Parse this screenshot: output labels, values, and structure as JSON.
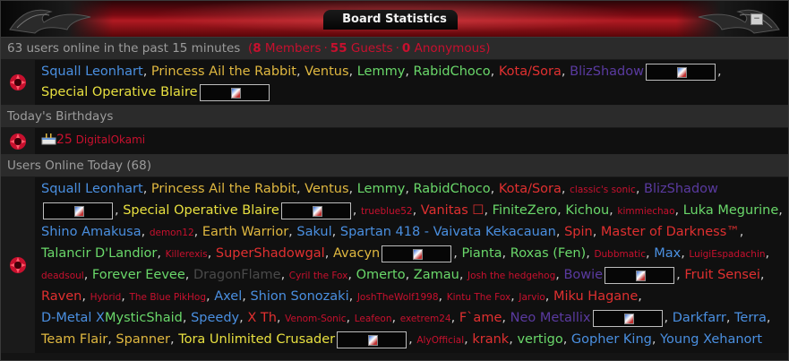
{
  "header": {
    "title": "Board Statistics",
    "collapse_label": "−"
  },
  "online": {
    "summary": "63 users online in the past 15 minutes",
    "members_count": "8",
    "members_label": "Members",
    "guests_count": "55",
    "guests_label": "Guests",
    "anon_count": "0",
    "anon_label": "Anonymous",
    "open_paren": "(",
    "close_paren": ")",
    "sep": "·",
    "users": [
      {
        "name": "Squall Leonhart",
        "color": "#4a8fe0"
      },
      {
        "name": "Princess Ail the Rabbit",
        "color": "#e0b840"
      },
      {
        "name": "Ventus",
        "color": "#e0b840"
      },
      {
        "name": "Lemmy",
        "color": "#6ad86a"
      },
      {
        "name": "RabidChoco",
        "color": "#6ad86a"
      },
      {
        "name": "Kota/Sora",
        "color": "#e03030"
      },
      {
        "name": "BlizShadow",
        "color": "#5a3aa0",
        "hidden": true,
        "newline_after": true
      },
      {
        "name": "Special Operative Blaire",
        "color": "#e8e040",
        "hidden": true,
        "last": true
      }
    ]
  },
  "birthdays": {
    "header": "Today's Birthdays",
    "age": "25",
    "name": "DigitalOkami",
    "color": "#c8102e"
  },
  "today": {
    "header": "Users Online Today (68)",
    "users": [
      {
        "name": "Squall Leonhart",
        "color": "#4a8fe0"
      },
      {
        "name": "Princess Ail the Rabbit",
        "color": "#e0b840"
      },
      {
        "name": "Ventus",
        "color": "#e0b840"
      },
      {
        "name": "Lemmy",
        "color": "#6ad86a"
      },
      {
        "name": "RabidChoco",
        "color": "#6ad86a"
      },
      {
        "name": "Kota/Sora",
        "color": "#e03030"
      },
      {
        "name": "classic's sonic",
        "color": "#c8102e",
        "small": true
      },
      {
        "name": "BlizShadow",
        "color": "#5a3aa0",
        "hidden": true
      },
      {
        "name": "Special Operative Blaire",
        "color": "#e8e040",
        "hidden": true
      },
      {
        "name": "trueblue52",
        "color": "#c8102e",
        "small": true
      },
      {
        "name": "Vanitas",
        "color": "#e03030",
        "suffix": " ☐"
      },
      {
        "name": "FiniteZero",
        "color": "#6ad86a"
      },
      {
        "name": "Kichou",
        "color": "#6ad86a"
      },
      {
        "name": "kimmiechao",
        "color": "#c8102e",
        "small": true
      },
      {
        "name": "Luka Megurine",
        "color": "#6ad86a"
      },
      {
        "name": "Shino Amakusa",
        "color": "#4a8fe0"
      },
      {
        "name": "demon12",
        "color": "#c8102e",
        "small": true
      },
      {
        "name": "Earth Warrior",
        "color": "#e0b840"
      },
      {
        "name": "Sakul",
        "color": "#4a8fe0"
      },
      {
        "name": "Spartan 418 - Vaivata Kekacauan",
        "color": "#4a8fe0"
      },
      {
        "name": "Spin",
        "color": "#e03030"
      },
      {
        "name": "Master of Darkness™",
        "color": "#e03030"
      },
      {
        "name": "Talancir D'Landior",
        "color": "#6ad86a"
      },
      {
        "name": "Killerexis",
        "color": "#c8102e",
        "small": true
      },
      {
        "name": "SuperShadowgal",
        "color": "#e03030"
      },
      {
        "name": "Avacyn",
        "color": "#e0b840",
        "hidden": true
      },
      {
        "name": "Pianta",
        "color": "#6ad86a"
      },
      {
        "name": "Roxas (Fen)",
        "color": "#6ad86a"
      },
      {
        "name": "Dubbmatic",
        "color": "#c8102e",
        "small": true
      },
      {
        "name": "Max",
        "color": "#4a8fe0"
      },
      {
        "name": "LuigiEspadachin",
        "color": "#c8102e",
        "small": true
      },
      {
        "name": "deadsoul",
        "color": "#c8102e",
        "small": true
      },
      {
        "name": "Forever Eevee",
        "color": "#6ad86a"
      },
      {
        "name": "DragonFlame",
        "color": "#4a4a4a"
      },
      {
        "name": "Cyril the Fox",
        "color": "#c8102e",
        "small": true
      },
      {
        "name": "Omerto",
        "color": "#6ad86a"
      },
      {
        "name": "Zamau",
        "color": "#6ad86a"
      },
      {
        "name": "Josh the hedgehog",
        "color": "#c8102e",
        "small": true
      },
      {
        "name": "Bowie",
        "color": "#5a3aa0",
        "hidden": true
      },
      {
        "name": "Fruit Sensei",
        "color": "#e03030"
      },
      {
        "name": "Raven",
        "color": "#e03030"
      },
      {
        "name": "Hybrid",
        "color": "#c8102e",
        "small": true
      },
      {
        "name": "The Blue PikHog",
        "color": "#c8102e",
        "small": true
      },
      {
        "name": "Axel",
        "color": "#4a8fe0"
      },
      {
        "name": "Shion Sonozaki",
        "color": "#4a8fe0"
      },
      {
        "name": "JoshTheWolf1998",
        "color": "#c8102e",
        "small": true
      },
      {
        "name": "Kintu The Fox",
        "color": "#c8102e",
        "small": true
      },
      {
        "name": "Jarvio",
        "color": "#c8102e",
        "small": true
      },
      {
        "name": "Miku Hagane",
        "color": "#e03030"
      },
      {
        "name": "D-Metal X",
        "color": "#4a8fe0",
        "nocomma": true
      },
      {
        "name": "MysticShaid",
        "color": "#6ad86a"
      },
      {
        "name": "Speedy",
        "color": "#4a8fe0"
      },
      {
        "name": "X Th",
        "color": "#e03030"
      },
      {
        "name": "Venom-Sonic",
        "color": "#c8102e",
        "small": true
      },
      {
        "name": "Leafeon",
        "color": "#c8102e",
        "small": true
      },
      {
        "name": "exetrem24",
        "color": "#c8102e",
        "small": true
      },
      {
        "name": "F`ame",
        "color": "#e03030"
      },
      {
        "name": "Neo Metallix",
        "color": "#5a3aa0",
        "hidden": true
      },
      {
        "name": "Darkfarr",
        "color": "#4a8fe0"
      },
      {
        "name": "Terra",
        "color": "#4a8fe0"
      },
      {
        "name": "Team Flair",
        "color": "#e0b840"
      },
      {
        "name": "Spanner",
        "color": "#e0b840"
      },
      {
        "name": "Tora Unlimited Crusader",
        "color": "#e8e040",
        "hidden": true
      },
      {
        "name": "AlyOfficial",
        "color": "#c8102e",
        "small": true
      },
      {
        "name": "krank",
        "color": "#e03030"
      },
      {
        "name": "vertigo",
        "color": "#6ad86a"
      },
      {
        "name": "Gopher King",
        "color": "#4a8fe0"
      },
      {
        "name": "Young Xehanort",
        "color": "#4a8fe0",
        "last": true
      }
    ]
  },
  "icons": {
    "row_icon": "red-flower-icon",
    "birthday_icon": "cake-icon",
    "hidden_user_icon": "hidden-user-badge-icon"
  }
}
